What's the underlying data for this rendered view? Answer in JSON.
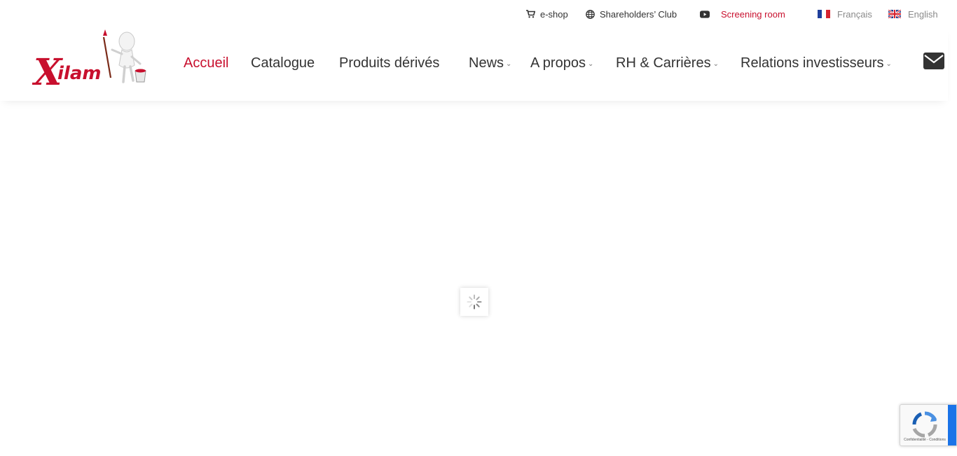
{
  "topbar": {
    "eshop": {
      "label": "e-shop",
      "icon": "cart-icon"
    },
    "shareholders": {
      "label": "Shareholders’ Club",
      "icon": "globe-icon"
    },
    "screening": {
      "label": "Screening room",
      "icon": "youtube-icon",
      "color": "#c8102e"
    },
    "languages": [
      {
        "label": "Français",
        "icon": "france-flag-icon"
      },
      {
        "label": "English",
        "icon": "uk-flag-icon"
      }
    ]
  },
  "header": {
    "logo_text": "Xilam",
    "nav": [
      {
        "label": "Accueil",
        "active": true
      },
      {
        "label": "Catalogue"
      },
      {
        "label": "Produits dérivés"
      },
      {
        "label": "News",
        "has_dropdown": true
      },
      {
        "label": "A propos",
        "has_dropdown": true
      },
      {
        "label": "RH & Carrières",
        "has_dropdown": true
      },
      {
        "label": "Relations investisseurs",
        "has_dropdown": true
      }
    ],
    "contact_icon": "envelope-icon"
  },
  "content": {
    "loading_icon": "spinner-icon"
  },
  "recaptcha": {
    "terms": "Confidentialité - Conditions",
    "icon": "recaptcha-icon"
  },
  "colors": {
    "accent": "#c8102e",
    "text": "#333333",
    "muted": "#8a8a8a",
    "recaptcha_blue": "#1a73e8"
  }
}
